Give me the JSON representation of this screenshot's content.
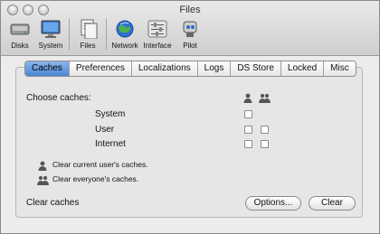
{
  "window": {
    "title": "Files"
  },
  "toolbar": {
    "groups": [
      [
        {
          "label": "Disks",
          "icon": "disk-icon"
        },
        {
          "label": "System",
          "icon": "monitor-icon"
        }
      ],
      [
        {
          "label": "Files",
          "icon": "files-icon"
        }
      ],
      [
        {
          "label": "Network",
          "icon": "globe-icon"
        },
        {
          "label": "Interface",
          "icon": "sliders-icon"
        },
        {
          "label": "Pilot",
          "icon": "robot-icon"
        }
      ]
    ]
  },
  "tabs": [
    "Caches",
    "Preferences",
    "Localizations",
    "Logs",
    "DS Store",
    "Locked",
    "Misc"
  ],
  "active_tab": "Caches",
  "caches": {
    "choose_label": "Choose caches:",
    "rows": [
      {
        "label": "System"
      },
      {
        "label": "User"
      },
      {
        "label": "Internet"
      }
    ]
  },
  "legend": {
    "current_user": "Clear current user's caches.",
    "everyone": "Clear everyone's caches."
  },
  "footer": {
    "clear_caches_label": "Clear caches",
    "options_button": "Options...",
    "clear_button": "Clear"
  }
}
